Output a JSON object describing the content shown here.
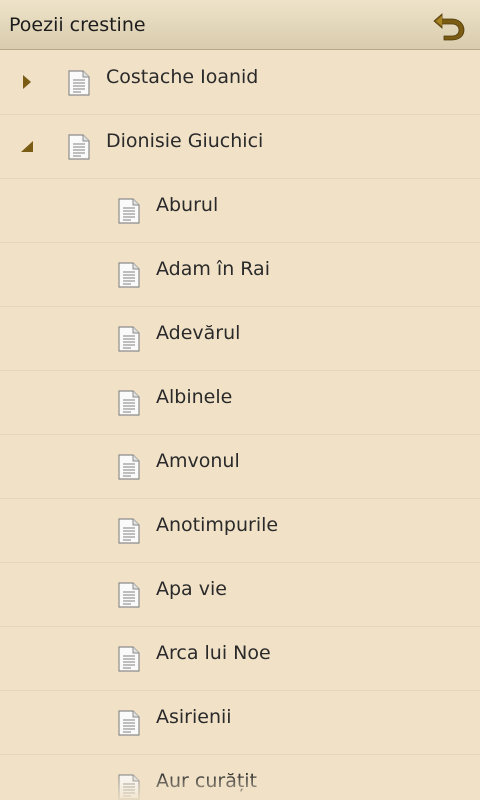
{
  "action_bar": {
    "title": "Poezii crestine",
    "back_icon": "undo-arrow-icon"
  },
  "colors": {
    "background": "#f1e2c7",
    "action_bar": "#e3d7bc",
    "divider": "#e6d6b9",
    "accent": "#7a5c14"
  },
  "tree": {
    "authors": [
      {
        "label": "Costache Ioanid",
        "expanded": false,
        "expander_icon": "triangle-right-icon"
      },
      {
        "label": "Dionisie Giuchici",
        "expanded": true,
        "expander_icon": "triangle-down-icon"
      }
    ],
    "poems": [
      {
        "label": "Aburul"
      },
      {
        "label": "Adam în Rai"
      },
      {
        "label": "Adevărul"
      },
      {
        "label": "Albinele"
      },
      {
        "label": "Amvonul"
      },
      {
        "label": "Anotimpurile"
      },
      {
        "label": "Apa vie"
      },
      {
        "label": "Arca lui Noe"
      },
      {
        "label": "Asirienii"
      },
      {
        "label": "Aur curățit"
      }
    ],
    "item_icon": "document-icon"
  }
}
